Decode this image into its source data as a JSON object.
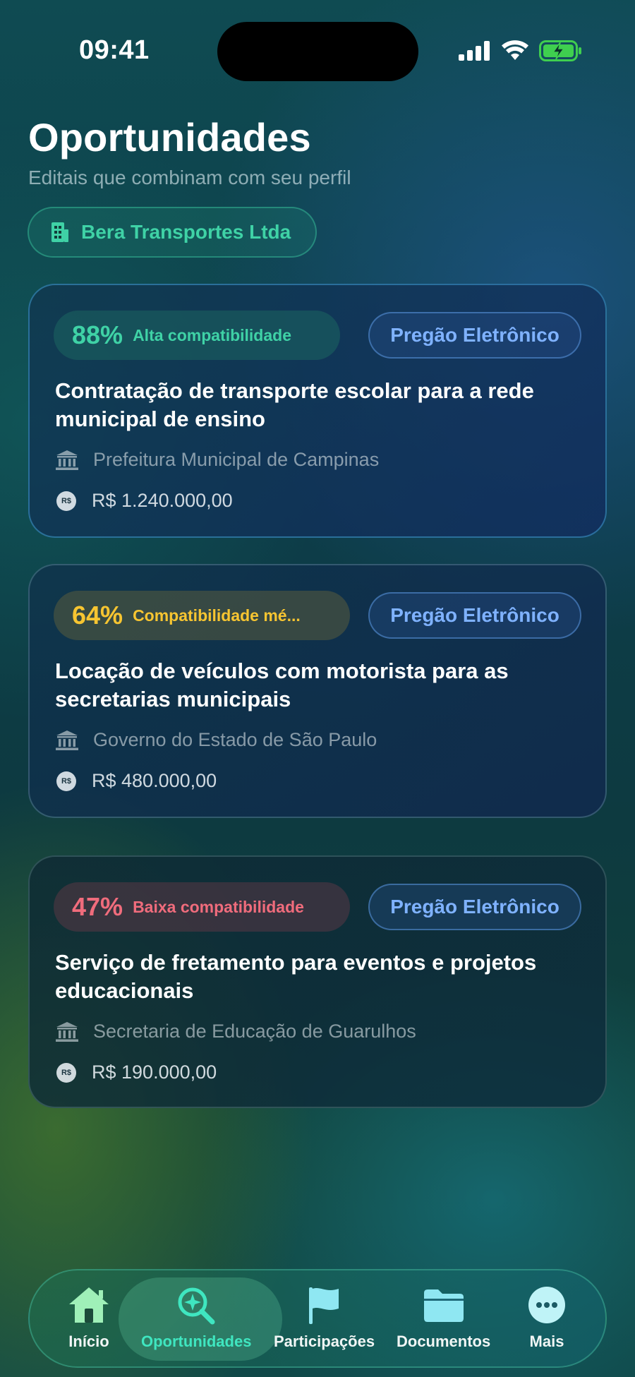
{
  "status": {
    "time": "09:41",
    "battery_color": "#3fcf4f"
  },
  "header": {
    "title": "Oportunidades",
    "subtitle": "Editais que combinam com seu perfil"
  },
  "company": {
    "name": "Bera Transportes Ltda",
    "icon": "building-icon",
    "color": "#3fd2a6"
  },
  "opportunities": [
    {
      "score": "88%",
      "score_label": "Alta compatibilidade",
      "score_color": "#3fd2a6",
      "modality": "Pregão Eletrônico",
      "title": "Contratação de transporte escolar para a rede municipal de ensino",
      "organization": "Prefeitura Municipal de Campinas",
      "value": "R$ 1.240.000,00"
    },
    {
      "score": "64%",
      "score_label": "Compatibilidade mé...",
      "score_color": "#f7c531",
      "modality": "Pregão Eletrônico",
      "title": "Locação de veículos com motorista para as secretarias municipais",
      "organization": "Governo do Estado de São Paulo",
      "value": "R$ 480.000,00"
    },
    {
      "score": "47%",
      "score_label": "Baixa compatibilidade",
      "score_color": "#f06c7c",
      "modality": "Pregão Eletrônico",
      "title": "Serviço de fretamento para eventos e projetos educacionais",
      "organization": "Secretaria de Educação de Guarulhos",
      "value": "R$ 190.000,00"
    }
  ],
  "icons": {
    "organization": "bank-icon",
    "value": "currency-icon",
    "currency_glyph": "R$"
  },
  "tabbar": {
    "active": "Oportunidades",
    "active_color": "#3fe6c0",
    "items": [
      {
        "label": "Início",
        "icon": "home-icon"
      },
      {
        "label": "Oportunidades",
        "icon": "search-sparkle-icon"
      },
      {
        "label": "Participações",
        "icon": "flag-icon"
      },
      {
        "label": "Documentos",
        "icon": "folder-icon"
      },
      {
        "label": "Mais",
        "icon": "more-icon"
      }
    ]
  }
}
